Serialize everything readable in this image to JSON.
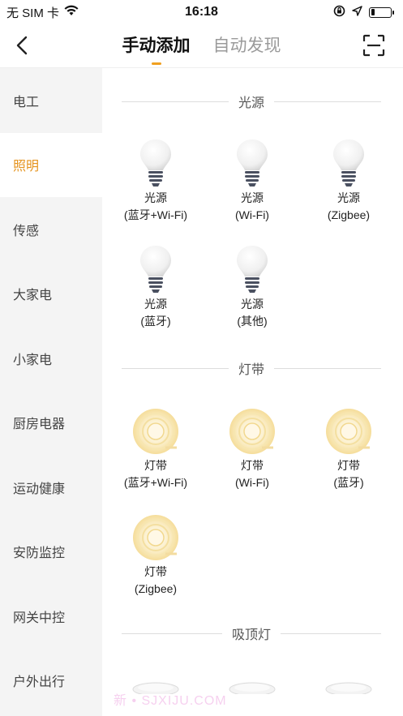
{
  "status_bar": {
    "carrier": "无 SIM 卡",
    "time": "16:18",
    "battery_level": 0.2
  },
  "header": {
    "tabs": [
      {
        "label": "手动添加",
        "active": true
      },
      {
        "label": "自动发现",
        "active": false
      }
    ]
  },
  "sidebar": {
    "items": [
      {
        "label": "电工",
        "active": false
      },
      {
        "label": "照明",
        "active": true
      },
      {
        "label": "传感",
        "active": false
      },
      {
        "label": "大家电",
        "active": false
      },
      {
        "label": "小家电",
        "active": false
      },
      {
        "label": "厨房电器",
        "active": false
      },
      {
        "label": "运动健康",
        "active": false
      },
      {
        "label": "安防监控",
        "active": false
      },
      {
        "label": "网关中控",
        "active": false
      },
      {
        "label": "户外出行",
        "active": false
      }
    ]
  },
  "sections": [
    {
      "title": "光源",
      "devices": [
        {
          "name": "光源",
          "sub": "(蓝牙+Wi-Fi)",
          "icon": "bulb-icon"
        },
        {
          "name": "光源",
          "sub": "(Wi-Fi)",
          "icon": "bulb-icon"
        },
        {
          "name": "光源",
          "sub": "(Zigbee)",
          "icon": "bulb-icon"
        },
        {
          "name": "光源",
          "sub": "(蓝牙)",
          "icon": "bulb-icon"
        },
        {
          "name": "光源",
          "sub": "(其他)",
          "icon": "bulb-icon"
        }
      ]
    },
    {
      "title": "灯带",
      "devices": [
        {
          "name": "灯带",
          "sub": "(蓝牙+Wi-Fi)",
          "icon": "light-strip-icon"
        },
        {
          "name": "灯带",
          "sub": "(Wi-Fi)",
          "icon": "light-strip-icon"
        },
        {
          "name": "灯带",
          "sub": "(蓝牙)",
          "icon": "light-strip-icon"
        },
        {
          "name": "灯带",
          "sub": "(Zigbee)",
          "icon": "light-strip-icon"
        }
      ]
    },
    {
      "title": "吸顶灯",
      "devices": []
    }
  ],
  "watermark": "新 • SJXIJU.COM",
  "colors": {
    "accent": "#e5931d",
    "sidebar_bg": "#f4f4f4"
  }
}
